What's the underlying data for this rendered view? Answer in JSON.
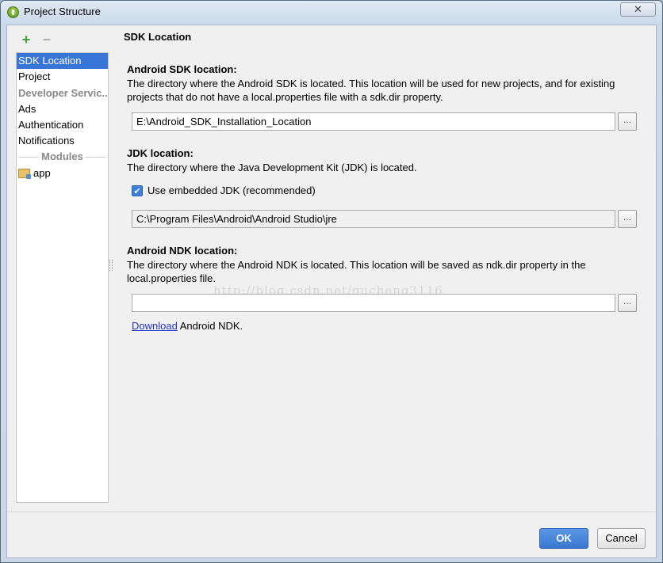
{
  "window": {
    "title": "Project Structure",
    "close_glyph": "✕"
  },
  "toolbar": {
    "add_glyph": "+",
    "remove_glyph": "−"
  },
  "sidebar": {
    "items": [
      {
        "label": "SDK Location"
      },
      {
        "label": "Project"
      }
    ],
    "group_label": "Developer Servic...",
    "group_items": [
      {
        "label": "Ads"
      },
      {
        "label": "Authentication"
      },
      {
        "label": "Notifications"
      }
    ],
    "modules_label": "Modules",
    "modules": [
      {
        "label": "app"
      }
    ]
  },
  "main": {
    "section_title": "SDK Location",
    "sdk": {
      "label": "Android SDK location:",
      "description": "The directory where the Android SDK is located. This location will be used for new projects, and for existing projects that do not have a local.properties file with a sdk.dir property.",
      "value": "E:\\Android_SDK_Installation_Location",
      "browse": "..."
    },
    "jdk": {
      "label": "JDK location:",
      "description": "The directory where the Java Development Kit (JDK) is located.",
      "checkbox_label": "Use embedded JDK (recommended)",
      "checkbox_checked": true,
      "value": "C:\\Program Files\\Android\\Android Studio\\jre",
      "browse": "..."
    },
    "ndk": {
      "label": "Android NDK location:",
      "description": "The directory where the Android NDK is located. This location will be saved as ndk.dir property in the local.properties file.",
      "value": "",
      "browse": "...",
      "download_link": "Download",
      "download_suffix": " Android NDK."
    },
    "watermark": "http://blog.csdn.net/gucheng3116"
  },
  "buttons": {
    "ok": "OK",
    "cancel": "Cancel"
  },
  "colors": {
    "selection": "#3875d7",
    "ok_button": "#3a76cc",
    "link": "#2233cc"
  }
}
